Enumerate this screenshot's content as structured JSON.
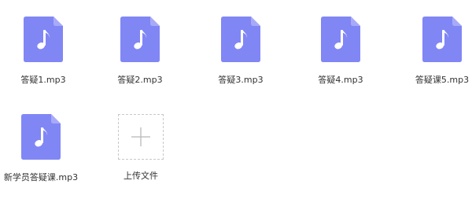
{
  "colors": {
    "file_icon": "#8186f5",
    "file_icon_fold": "#a7aaf8",
    "plus": "#bdbdbd"
  },
  "files": [
    {
      "name": "答疑1.mp3",
      "icon": "music-note-icon"
    },
    {
      "name": "答疑2.mp3",
      "icon": "music-note-icon"
    },
    {
      "name": "答疑3.mp3",
      "icon": "music-note-icon"
    },
    {
      "name": "答疑4.mp3",
      "icon": "music-note-icon"
    },
    {
      "name": "答疑课5.mp3",
      "icon": "music-note-icon"
    },
    {
      "name": "新学员答疑课.mp3",
      "icon": "music-note-icon"
    }
  ],
  "upload": {
    "label": "上传文件",
    "icon": "plus-icon"
  }
}
